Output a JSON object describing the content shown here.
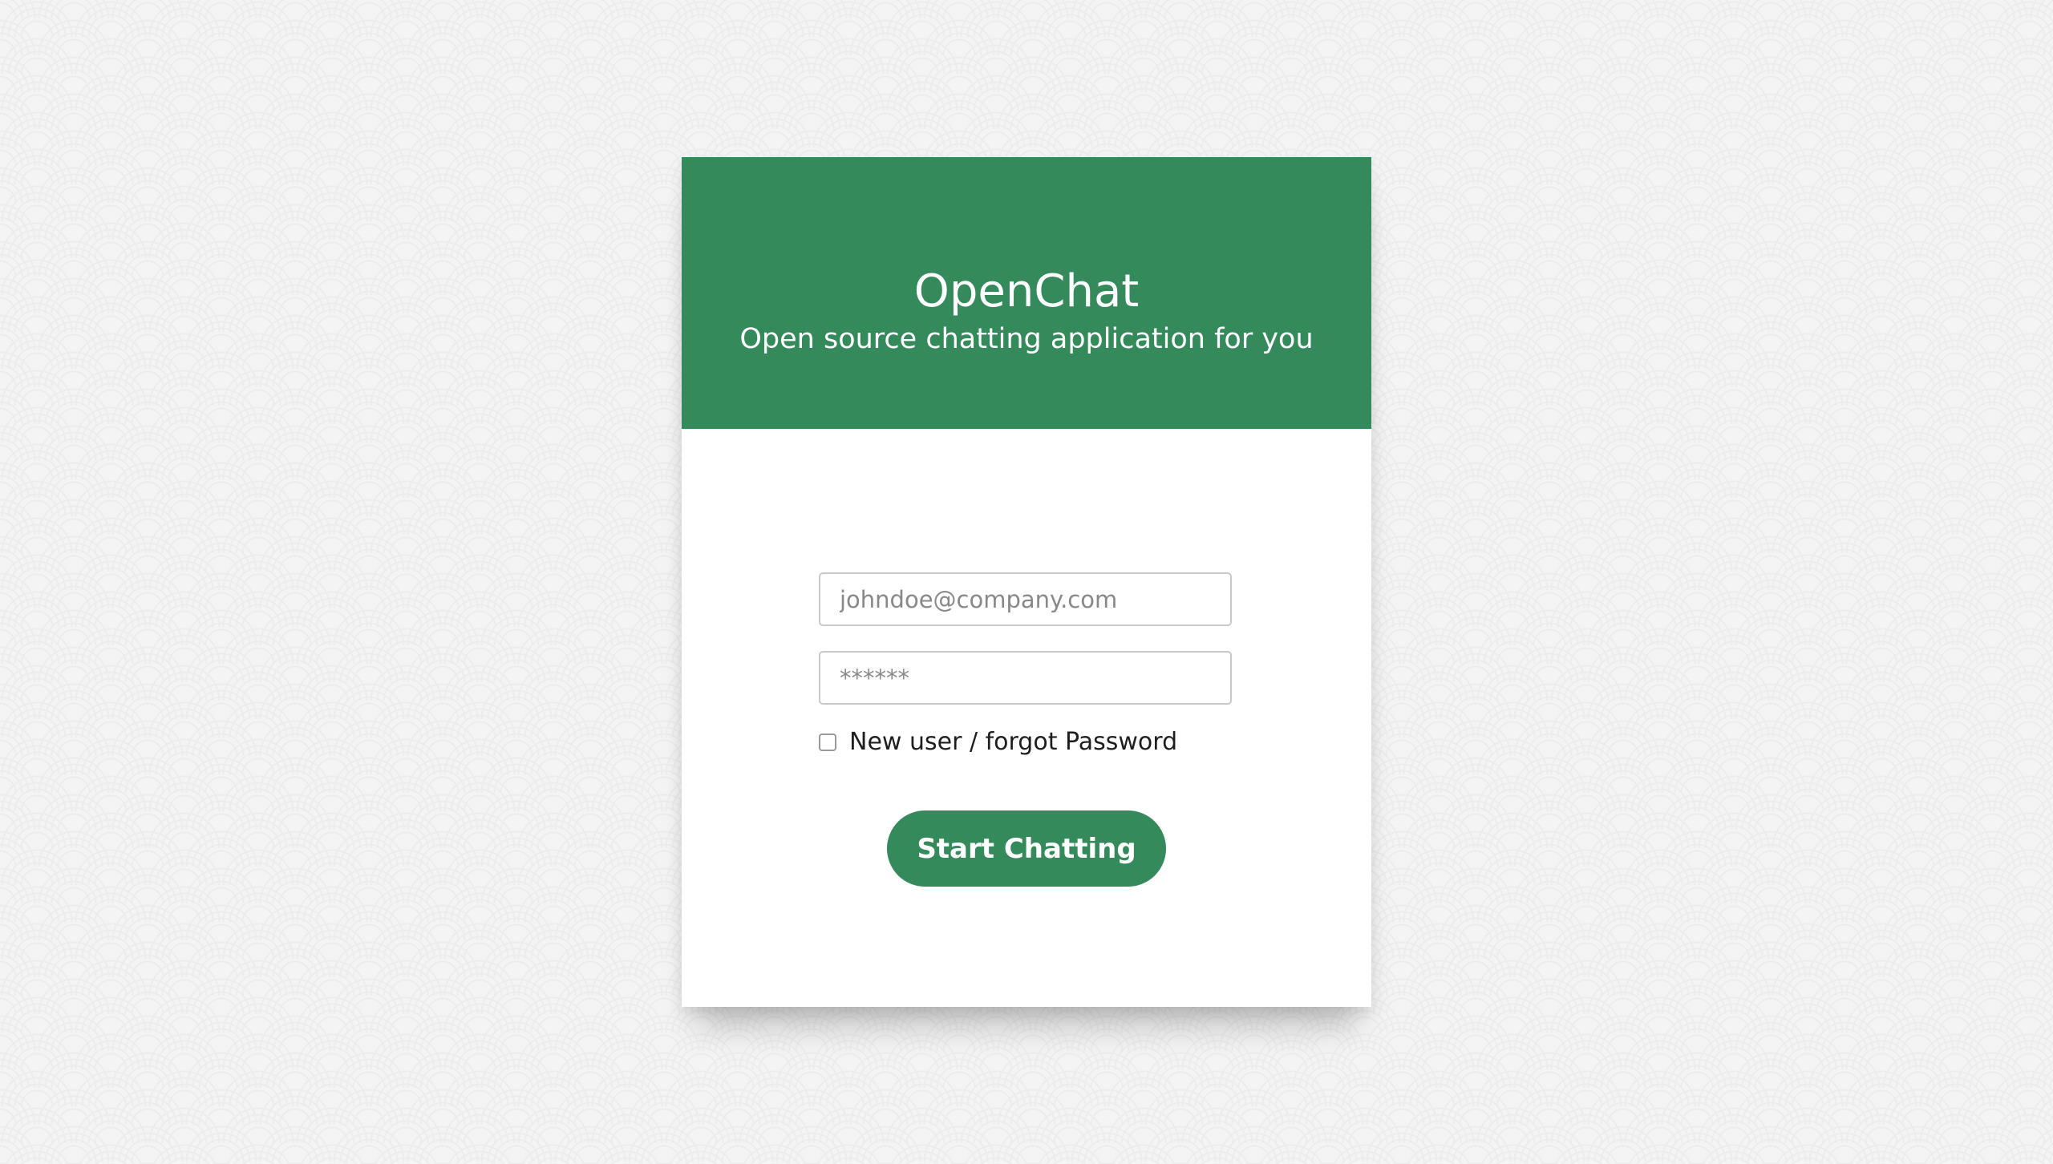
{
  "header": {
    "title": "OpenChat",
    "subtitle": "Open source chatting application for you"
  },
  "form": {
    "email_placeholder": "johndoe@company.com",
    "email_value": "",
    "password_placeholder": "******",
    "password_value": "",
    "checkbox_label": "New user / forgot Password",
    "checkbox_checked": false,
    "submit_label": "Start Chatting"
  },
  "colors": {
    "brand": "#348a5b",
    "background": "#f4f4f4",
    "card": "#ffffff"
  }
}
